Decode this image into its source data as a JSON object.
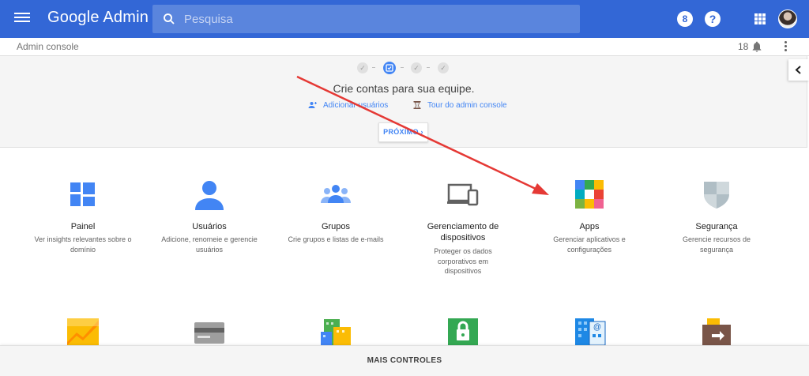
{
  "appbar": {
    "brand": "Google Admin",
    "search_placeholder": "Pesquisa",
    "support_badge": "8",
    "help_label": "?"
  },
  "subbar": {
    "breadcrumb": "Admin console",
    "notification_count": "18"
  },
  "onboarding": {
    "step_check": "✓",
    "title": "Crie contas para sua equipe.",
    "add_users": "Adicionar usuários",
    "tour": "Tour do admin console",
    "next": "PRÓXIMO ›"
  },
  "tiles": [
    {
      "name": "Painel",
      "desc": "Ver insights relevantes sobre o domínio"
    },
    {
      "name": "Usuários",
      "desc": "Adicione, renomeie e gerencie usuários"
    },
    {
      "name": "Grupos",
      "desc": "Crie grupos e listas de e-mails"
    },
    {
      "name": "Gerenciamento de dispositivos",
      "desc": "Proteger os dados corporativos em dispositivos"
    },
    {
      "name": "Apps",
      "desc": "Gerenciar aplicativos e configurações"
    },
    {
      "name": "Segurança",
      "desc": "Gerencie recursos de segurança"
    }
  ],
  "bottom": {
    "more_controls": "MAIS CONTROLES"
  },
  "colors": {
    "appbar": "#3367d6",
    "accent": "#4285f4",
    "annotation_arrow": "#e53935"
  }
}
